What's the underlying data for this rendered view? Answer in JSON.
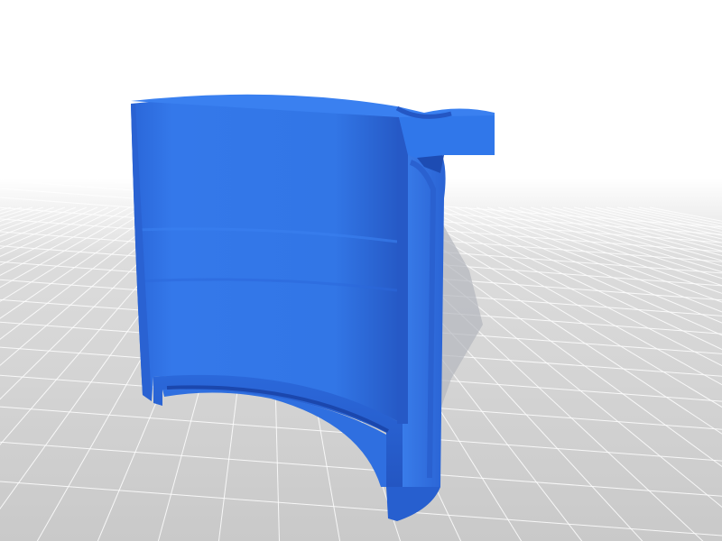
{
  "scene": {
    "subject": "3d-printed-half-cylinder-part",
    "colors": {
      "background_top": "#ffffff",
      "background_floor": "#d7d7d7",
      "grid_line": "#ffffff",
      "part_main": "#2f6fe0",
      "part_light": "#3a80f0",
      "part_dark": "#1f4fb8",
      "part_shadow": "#1a44a8",
      "floor_shadow": "#b9b9be"
    }
  }
}
